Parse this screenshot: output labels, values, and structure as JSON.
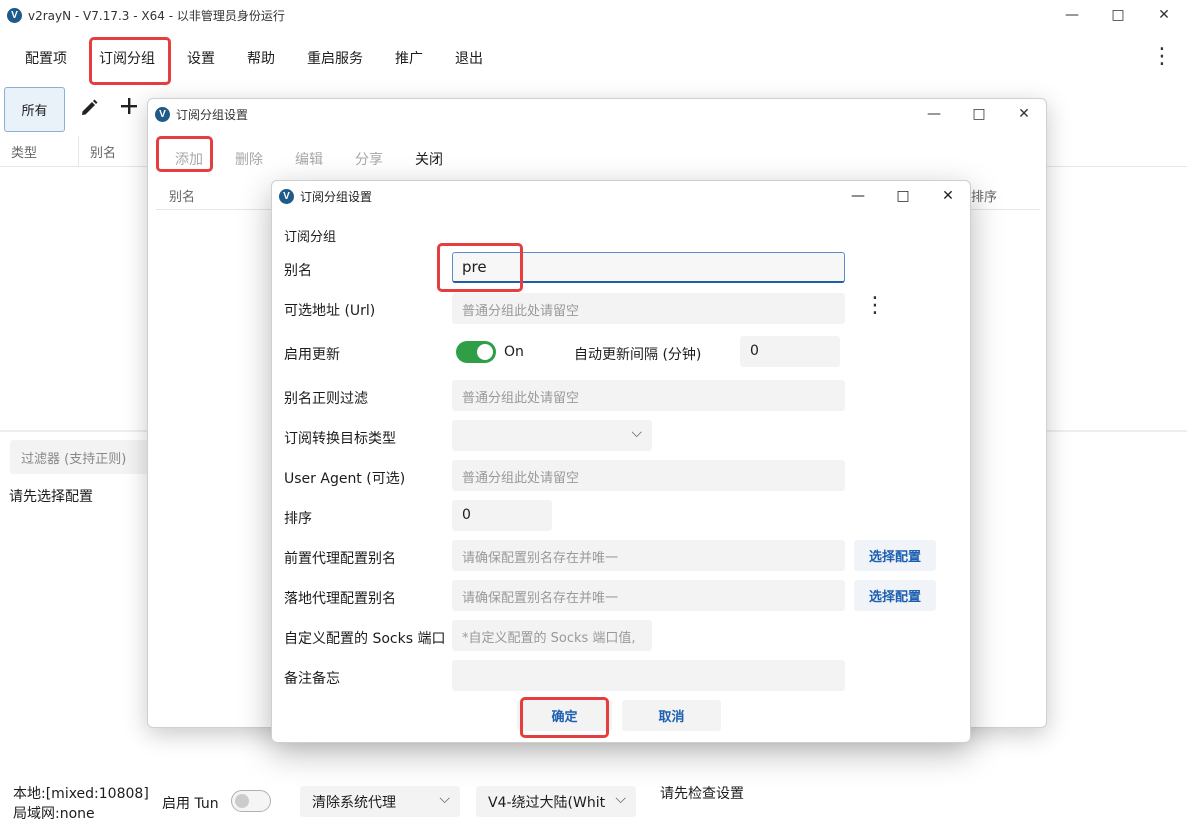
{
  "window": {
    "title": "v2rayN - V7.17.3 - X64 - 以非管理员身份运行",
    "logo_char": "V"
  },
  "menu": {
    "items": [
      "配置项",
      "订阅分组",
      "设置",
      "帮助",
      "重启服务",
      "推广",
      "退出"
    ]
  },
  "main": {
    "chip_all": "所有",
    "col_type": "类型",
    "col_alias": "别名",
    "filter_placeholder": "过滤器 (支持正则)",
    "hint": "请先选择配置"
  },
  "status_bar": {
    "local": "本地:[mixed:10808]",
    "lan": "局域网:none",
    "tun_label": "启用 Tun",
    "proxy_mode": "清除系统代理",
    "routing": "V4-绕过大陆(Whit",
    "check_hint": "请先检查设置"
  },
  "sub_window": {
    "title": "订阅分组设置",
    "toolbar": {
      "add": "添加",
      "delete": "删除",
      "edit": "编辑",
      "share": "分享",
      "close": "关闭"
    },
    "col_alias": "别名",
    "col_sort": "排序"
  },
  "dialog": {
    "title": "订阅分组设置",
    "section": "订阅分组",
    "alias_label": "别名",
    "alias_value": "pre",
    "url_label": "可选地址 (Url)",
    "url_placeholder": "普通分组此处请留空",
    "enable_update_label": "启用更新",
    "enable_update_state": "On",
    "interval_label": "自动更新间隔 (分钟)",
    "interval_value": "0",
    "filter_label": "别名正则过滤",
    "filter_placeholder": "普通分组此处请留空",
    "convert_label": "订阅转换目标类型",
    "ua_label": "User Agent (可选)",
    "ua_placeholder": "普通分组此处请留空",
    "sort_label": "排序",
    "sort_value": "0",
    "prev_proxy_label": "前置代理配置别名",
    "prev_proxy_placeholder": "请确保配置别名存在并唯一",
    "prev_proxy_button": "选择配置",
    "next_proxy_label": "落地代理配置别名",
    "next_proxy_placeholder": "请确保配置别名存在并唯一",
    "next_proxy_button": "选择配置",
    "socks_label": "自定义配置的 Socks 端口",
    "socks_placeholder": "*自定义配置的 Socks 端口值,",
    "memo_label": "备注备忘",
    "ok": "确定",
    "cancel": "取消"
  },
  "colors": {
    "accent": "#1e5ea8",
    "toggle_on": "#2e9e47",
    "highlight": "#e53e3e"
  }
}
